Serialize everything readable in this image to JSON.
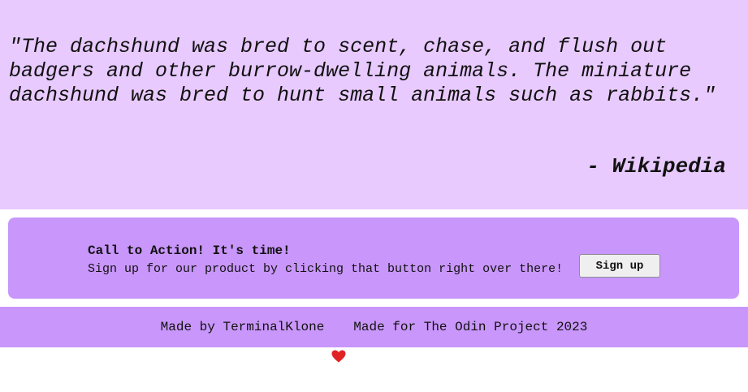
{
  "quote": {
    "text": "\"The dachshund was bred to scent, chase, and flush out badgers and other burrow-dwelling animals. The miniature dachshund was bred to hunt small animals such as rabbits.\"",
    "author": "- Wikipedia"
  },
  "cta": {
    "title": "Call to Action! It's time!",
    "text": "Sign up for our product by clicking that button right over there!",
    "button_label": "Sign up"
  },
  "footer": {
    "left_text": "Made by TerminalKlone",
    "heart_icon": "heart-icon",
    "right_text": "Made for The Odin Project 2023"
  },
  "colors": {
    "quote_background": "#e8caff",
    "accent_purple": "#c996fb",
    "heart": "#e02424"
  }
}
